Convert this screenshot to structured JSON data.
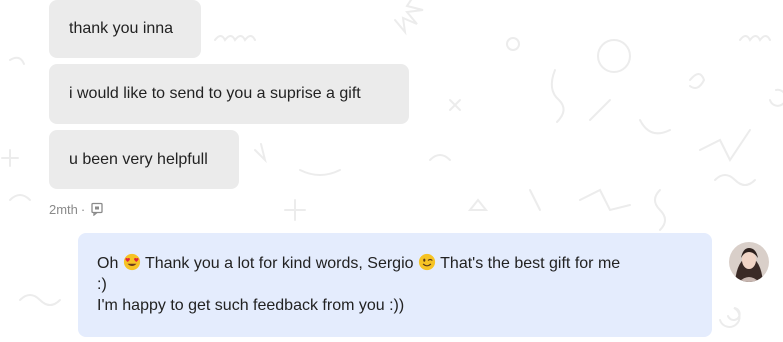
{
  "incoming_messages": [
    {
      "text": "thank you inna"
    },
    {
      "text": "i would like to send to you a suprise a gift"
    },
    {
      "text": "u been very helpfull"
    }
  ],
  "meta": {
    "timestamp": "2mth",
    "separator": "·",
    "status_icon": "seen-icon"
  },
  "outgoing_message": {
    "part1": "Oh ",
    "emoji1": "heart-eyes-emoji",
    "part2": " Thank you a lot for kind  words, Sergio ",
    "emoji2": "wink-emoji",
    "part3": " That's the best gift for me",
    "part4": ":)",
    "part5": "I'm happy to get such feedback from you :))"
  },
  "colors": {
    "incoming_bubble": "#ebebeb",
    "outgoing_bubble": "#e4ecfd",
    "text": "#222222",
    "meta_text": "#8a8a8a"
  }
}
